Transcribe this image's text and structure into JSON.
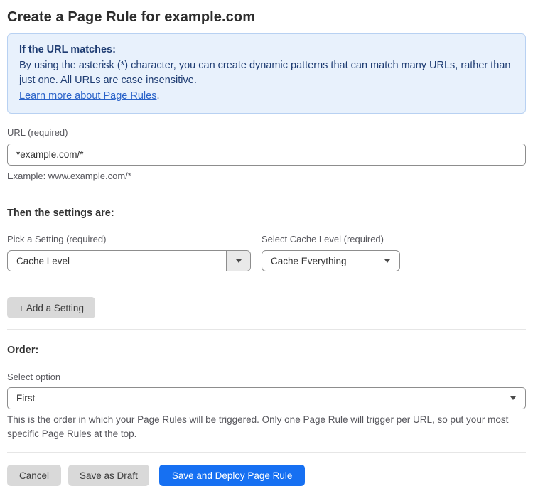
{
  "page": {
    "title": "Create a Page Rule for example.com"
  },
  "info_box": {
    "heading": "If the URL matches:",
    "body": "By using the asterisk (*) character, you can create dynamic patterns that can match many URLs, rather than just one. All URLs are case insensitive.",
    "link_label": "Learn more about Page Rules",
    "link_suffix": "."
  },
  "url_field": {
    "label": "URL (required)",
    "value": "*example.com/*",
    "hint": "Example: www.example.com/*"
  },
  "settings": {
    "heading": "Then the settings are:",
    "setting_picker": {
      "label": "Pick a Setting (required)",
      "value": "Cache Level"
    },
    "cache_level_picker": {
      "label": "Select Cache Level (required)",
      "value": "Cache Everything"
    },
    "add_button_label": "+ Add a Setting"
  },
  "order": {
    "heading": "Order:",
    "select_label": "Select option",
    "value": "First",
    "help": "This is the order in which your Page Rules will be triggered. Only one Page Rule will trigger per URL, so put your most specific Page Rules at the top."
  },
  "footer": {
    "cancel_label": "Cancel",
    "save_draft_label": "Save as Draft",
    "save_deploy_label": "Save and Deploy Page Rule"
  },
  "colors": {
    "info_background": "#e8f1fc",
    "info_border": "#b8d1f2",
    "info_text": "#1e3c72",
    "link": "#2a63c9",
    "primary_button": "#1670f2",
    "gray_button": "#d9d9d9",
    "input_border": "#8d8d8d",
    "divider": "#e6e6e6",
    "label_text": "#56565c"
  }
}
